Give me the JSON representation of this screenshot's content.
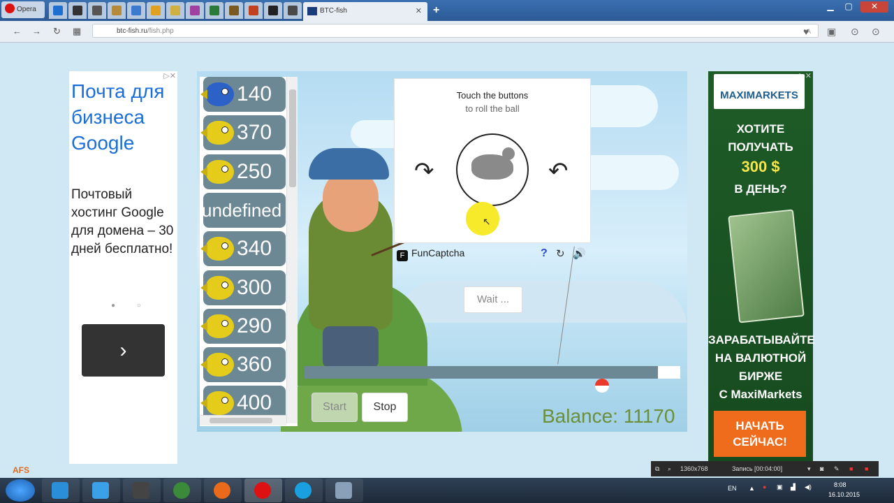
{
  "browser": {
    "menu_label": "Opera",
    "active_tab_title": "BTC-fish",
    "url_domain": "btc-fish.ru",
    "url_path": "/fish.php",
    "translate_label": "A"
  },
  "ad_left": {
    "headline": "Почта для бизнеса Google",
    "body": "Почтовый хостинг Google для домена – 30 дней бесплатно!",
    "pager": "● ○",
    "next_arrow": "›"
  },
  "fish_list": [
    {
      "value": "140",
      "kind": "blue"
    },
    {
      "value": "370",
      "kind": "yellow"
    },
    {
      "value": "250",
      "kind": "yellow"
    },
    {
      "value": "undefined",
      "kind": "none"
    },
    {
      "value": "340",
      "kind": "yellow"
    },
    {
      "value": "300",
      "kind": "yellow"
    },
    {
      "value": "290",
      "kind": "yellow"
    },
    {
      "value": "360",
      "kind": "yellow"
    },
    {
      "value": "400",
      "kind": "yellow"
    }
  ],
  "captcha": {
    "line1": "Touch the buttons",
    "line2": "to roll the ball",
    "brand": "FunCaptcha",
    "help": "?",
    "logo_letter": "F"
  },
  "game": {
    "wait_label": "Wait ...",
    "start_label": "Start",
    "stop_label": "Stop",
    "balance_label": "Balance:",
    "balance_value": "11170",
    "progress": 0.94
  },
  "ad_right": {
    "logo": "MAXIMARKETS",
    "q1": "ХОТИТЕ",
    "q2": "ПОЛУЧАТЬ",
    "amount": "300 $",
    "q3": "В ДЕНЬ?",
    "s1": "ЗАРАБАТЫВАЙТЕ",
    "s2": "НА ВАЛЮТНОЙ",
    "s3": "БИРЖЕ",
    "s4": "С MaxiMarkets",
    "cta1": "НАЧАТЬ",
    "cta2": "СЕЙЧАС!"
  },
  "afs_logo": "AFS",
  "recorder": {
    "resolution": "1360x768",
    "status": "Запись [00:04:00]"
  },
  "tray": {
    "lang": "EN",
    "time": "8:08",
    "date": "16.10.2015"
  },
  "colors": {
    "accent_blue": "#1a6ed8",
    "fish_row": "#6c8895",
    "balance": "#6c8f3a",
    "cta": "#ee6c1c"
  }
}
